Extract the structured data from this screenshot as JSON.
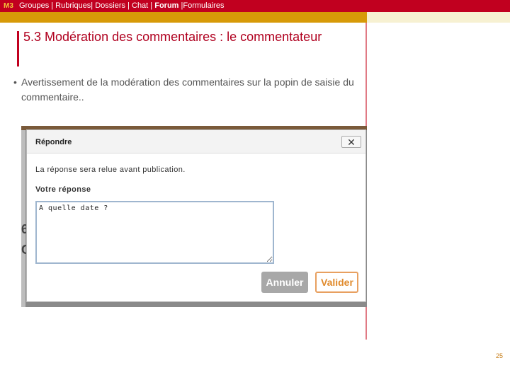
{
  "nav": {
    "badge": "M3",
    "links": [
      "Groupes |",
      "Rubriques|",
      "Dossiers |",
      "Chat |",
      "Forum",
      "|Formulaires"
    ]
  },
  "slide": {
    "title": "5.3 Modération des commentaires : le commentateur",
    "bullet_symbol": "•",
    "bullet": "Avertissement de la modération des commentaires sur la popin de saisie du commentaire..",
    "page_number": "25"
  },
  "dialog": {
    "title": "Répondre",
    "close": "✕",
    "notice": "La réponse sera relue avant publication.",
    "label": "Votre réponse",
    "textarea_value": "A quelle date ?",
    "cancel_label": "Annuler",
    "submit_label": "Valider"
  },
  "background": {
    "fragments": [
      "6",
      "C"
    ]
  }
}
